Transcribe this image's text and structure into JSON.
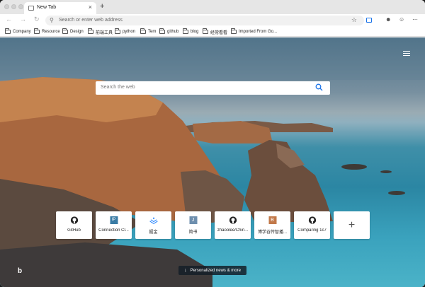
{
  "tab": {
    "title": "New Tab",
    "close": "×",
    "new": "+"
  },
  "nav": {
    "back": "←",
    "forward": "→",
    "refresh": "↻"
  },
  "address": {
    "placeholder": "Search or enter web address"
  },
  "bookmarks": [
    {
      "label": "Company"
    },
    {
      "label": "Resource"
    },
    {
      "label": "Design"
    },
    {
      "label": "前端工具"
    },
    {
      "label": "python"
    },
    {
      "label": "Tem"
    },
    {
      "label": "github"
    },
    {
      "label": "blog"
    },
    {
      "label": "经常看看"
    },
    {
      "label": "Imported From Go..."
    }
  ],
  "search": {
    "placeholder": "Search the web"
  },
  "tiles": [
    {
      "label": "GitHub",
      "icon": "github-icon"
    },
    {
      "label": "Connection Cl...",
      "icon": "ip-icon",
      "glyph": "IP",
      "color": "#3a7ca5"
    },
    {
      "label": "掘金",
      "icon": "juejin-icon",
      "color": "#1e80ff"
    },
    {
      "label": "简书",
      "icon": "jianshu-icon",
      "glyph": "J",
      "color": "#6e8fae"
    },
    {
      "label": "zhaoolee/Chin...",
      "icon": "github-icon"
    },
    {
      "label": "博学谷传智播...",
      "icon": "boxuegu-icon",
      "glyph": "B",
      "color": "#c2794a"
    },
    {
      "label": "Comparing 1c7",
      "icon": "github-icon"
    }
  ],
  "add_tile": {
    "label": "+"
  },
  "news": {
    "label": "Personalized news & more",
    "arrow": "↓"
  },
  "brand": {
    "bing": "b"
  }
}
